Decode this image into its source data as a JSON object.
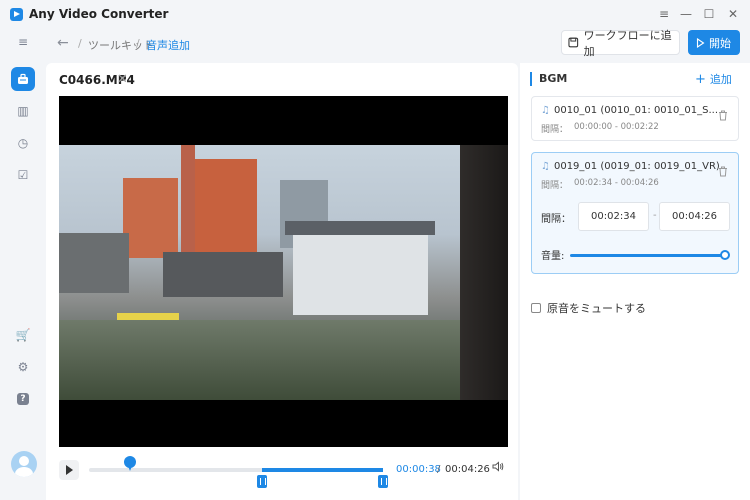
{
  "app": {
    "title": "Any Video Converter"
  },
  "window_controls": {
    "menu": "≡",
    "minimize": "—",
    "maximize": "☐",
    "close": "✕"
  },
  "sidebar": {
    "items": [
      {
        "name": "menu",
        "glyph": "≡"
      },
      {
        "name": "toolkit",
        "glyph": "⚙"
      },
      {
        "name": "library",
        "glyph": "▥"
      },
      {
        "name": "history",
        "glyph": "◷"
      },
      {
        "name": "tasks",
        "glyph": "☑"
      }
    ],
    "bottom": {
      "cart": "🛒",
      "settings": "⚙",
      "help": "?"
    }
  },
  "header": {
    "back": "←",
    "breadcrumb": [
      "ツールキット",
      "音声追加"
    ],
    "workflow_button": "ワークフローに追加",
    "start_button": "開始"
  },
  "video": {
    "file_name": "C0466.MP4",
    "close_glyph": "✕",
    "current_time": "00:00:38",
    "separator": "/",
    "total_time": "00:04:26",
    "playhead_fraction": 0.14,
    "selection_start_fraction": 0.59,
    "selection_end_fraction": 1.0
  },
  "bgm": {
    "title": "BGM",
    "add_label": "追加",
    "tracks": [
      {
        "name": "0010_01 (0010_01: 0010_01_S...",
        "interval_label": "間隔：",
        "range": "00:00:00 - 00:02:22"
      },
      {
        "name": "0019_01 (0019_01: 0019_01_VR)",
        "interval_label": "間隔：",
        "range": "00:02:34 - 00:04:26"
      }
    ],
    "selected": {
      "interval_label": "間隔：",
      "start": "00:02:34",
      "dash": "-",
      "end": "00:04:26",
      "volume_label": "音量:",
      "volume_fraction": 1.0
    },
    "mute_label": "原音をミュートする"
  },
  "colors": {
    "accent": "#1e88e5",
    "background": "#f3f5f8"
  }
}
